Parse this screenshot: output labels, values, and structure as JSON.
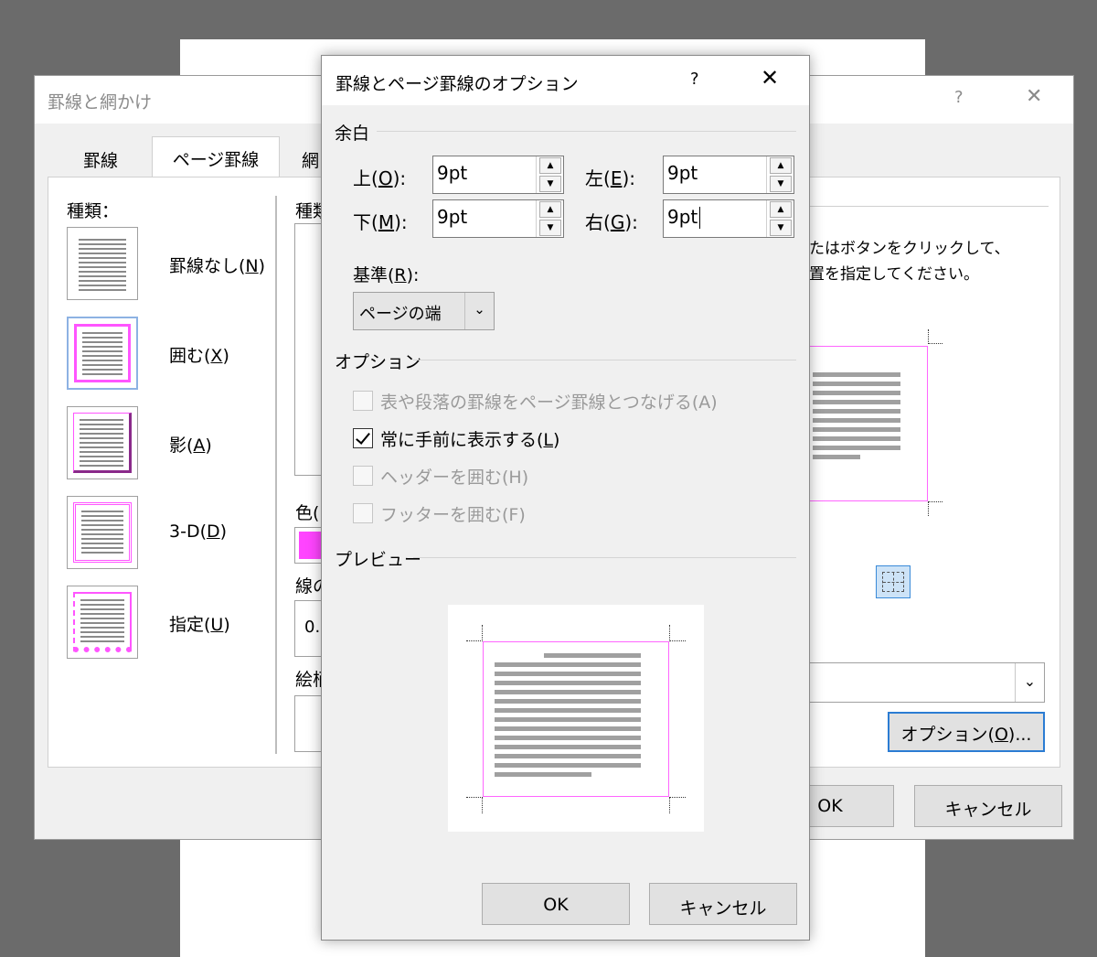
{
  "back_dialog": {
    "title": "罫線と網かけ",
    "help": "?",
    "close": "✕",
    "tabs": [
      "罫線",
      "ページ罫線",
      "網"
    ],
    "setting": {
      "header": "種類：",
      "items": [
        {
          "label": "罫線なし(",
          "key": "N"
        },
        {
          "label": "囲む(",
          "key": "X"
        },
        {
          "label": "影(",
          "key": "A"
        },
        {
          "label": "3-D(",
          "key": "D"
        },
        {
          "label": "指定(",
          "key": "U"
        }
      ]
    },
    "style_label": "種類",
    "color_label": "色(",
    "color_value": "#ff44ff",
    "width_label": "線の",
    "width_value": "0.",
    "art_label": "絵柄",
    "hint": [
      "たはボタンをクリックして、",
      "置を指定してください。"
    ],
    "options_button": {
      "label": "オプション(",
      "key": "O",
      "suffix": ")..."
    },
    "ok": "OK",
    "cancel": "キャンセル"
  },
  "front_dialog": {
    "title": "罫線とページ罫線のオプション",
    "help": "?",
    "close": "✕",
    "margin_group": "余白",
    "margins": {
      "top": {
        "label": "上(",
        "key": "O",
        "value": "9pt"
      },
      "bottom": {
        "label": "下(",
        "key": "M",
        "value": "9pt"
      },
      "left": {
        "label": "左(",
        "key": "E",
        "value": "9pt"
      },
      "right": {
        "label": "右(",
        "key": "G",
        "value": "9pt"
      }
    },
    "basis": {
      "label": "基準(",
      "key": "R",
      "value": "ページの端"
    },
    "options_group": "オプション",
    "options": [
      {
        "label": "表や段落の罫線をページ罫線とつなげる(A)",
        "checked": false,
        "enabled": false
      },
      {
        "label": "常に手前に表示する(",
        "key": "L",
        "checked": true,
        "enabled": true
      },
      {
        "label": "ヘッダーを囲む(H)",
        "checked": false,
        "enabled": false
      },
      {
        "label": "フッターを囲む(F)",
        "checked": false,
        "enabled": false
      }
    ],
    "preview_group": "プレビュー",
    "border_color": "#ff66ff",
    "ok": "OK",
    "cancel": "キャンセル"
  }
}
